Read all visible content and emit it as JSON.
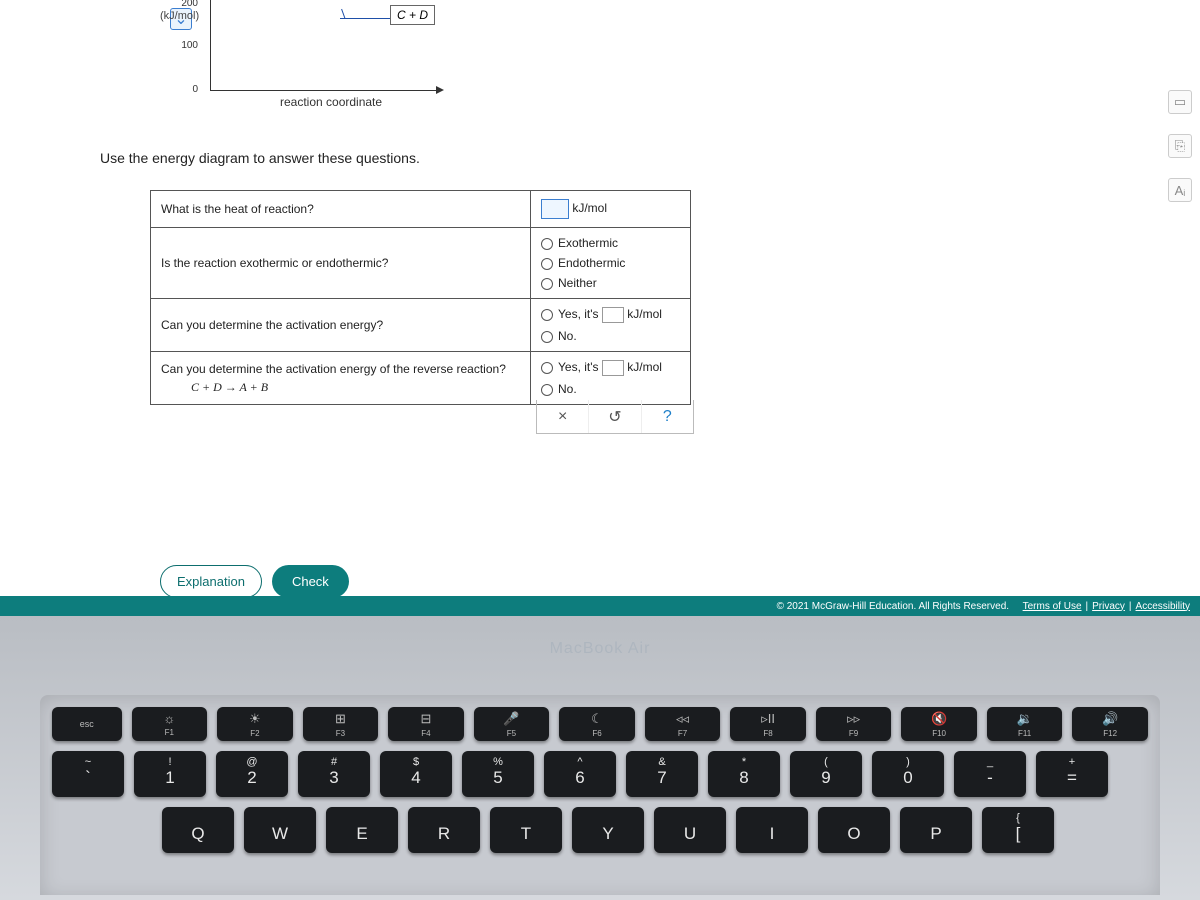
{
  "chart_data": {
    "type": "line",
    "title": "",
    "xlabel": "reaction coordinate",
    "ylabel": "(kJ/mol)",
    "ylim": [
      0,
      200
    ],
    "y_ticks": [
      0,
      100,
      200
    ],
    "annotations": [
      "C + D"
    ],
    "note": "Partial energy diagram; only upper-right segment near C+D product level (~200 kJ/mol) visible plus axes."
  },
  "instruction": "Use the energy diagram to answer these questions.",
  "questions": {
    "q1": "What is the heat of reaction?",
    "q2": "Is the reaction exothermic or endothermic?",
    "q3": "Can you determine the activation energy?",
    "q4a": "Can you determine the activation energy of the reverse reaction?",
    "q4b": "C + D → A + B"
  },
  "answers": {
    "unit": "kJ/mol",
    "opt_exo": "Exothermic",
    "opt_endo": "Endothermic",
    "opt_neither": "Neither",
    "opt_yes_prefix": "Yes,  it's",
    "opt_yes_unit": "kJ/mol",
    "opt_no": "No."
  },
  "toolbar": {
    "clear": "×",
    "reset": "↺",
    "help": "?"
  },
  "buttons": {
    "explanation": "Explanation",
    "check": "Check"
  },
  "footer": {
    "copyright": "© 2021 McGraw-Hill Education. All Rights Reserved.",
    "terms": "Terms of Use",
    "privacy": "Privacy",
    "accessibility": "Accessibility"
  },
  "side_icons": {
    "a": "▭",
    "b": "⎘",
    "c": "Aᵢ"
  },
  "laptop": {
    "brand": "MacBook Air",
    "fn_row": {
      "esc": "esc",
      "keys": [
        {
          "icon": "☼",
          "label": "F1"
        },
        {
          "icon": "☀",
          "label": "F2"
        },
        {
          "icon": "⊞",
          "label": "F3"
        },
        {
          "icon": "⊟",
          "label": "F4"
        },
        {
          "icon": "🎤",
          "label": "F5"
        },
        {
          "icon": "☾",
          "label": "F6"
        },
        {
          "icon": "◃◃",
          "label": "F7"
        },
        {
          "icon": "▹II",
          "label": "F8"
        },
        {
          "icon": "▹▹",
          "label": "F9"
        },
        {
          "icon": "🔇",
          "label": "F10"
        },
        {
          "icon": "🔉",
          "label": "F11"
        },
        {
          "icon": "🔊",
          "label": "F12"
        }
      ]
    },
    "num_row": [
      {
        "top": "~",
        "mid": "`"
      },
      {
        "top": "!",
        "mid": "1"
      },
      {
        "top": "@",
        "mid": "2"
      },
      {
        "top": "#",
        "mid": "3"
      },
      {
        "top": "$",
        "mid": "4"
      },
      {
        "top": "%",
        "mid": "5"
      },
      {
        "top": "^",
        "mid": "6"
      },
      {
        "top": "&",
        "mid": "7"
      },
      {
        "top": "*",
        "mid": "8"
      },
      {
        "top": "(",
        "mid": "9"
      },
      {
        "top": ")",
        "mid": "0"
      },
      {
        "top": "_",
        "mid": "-"
      },
      {
        "top": "+",
        "mid": "="
      }
    ],
    "letter_row": [
      "Q",
      "W",
      "E",
      "R",
      "T",
      "Y",
      "U",
      "I",
      "O",
      "P"
    ],
    "letter_tail": [
      {
        "top": "{",
        "mid": "["
      }
    ]
  }
}
